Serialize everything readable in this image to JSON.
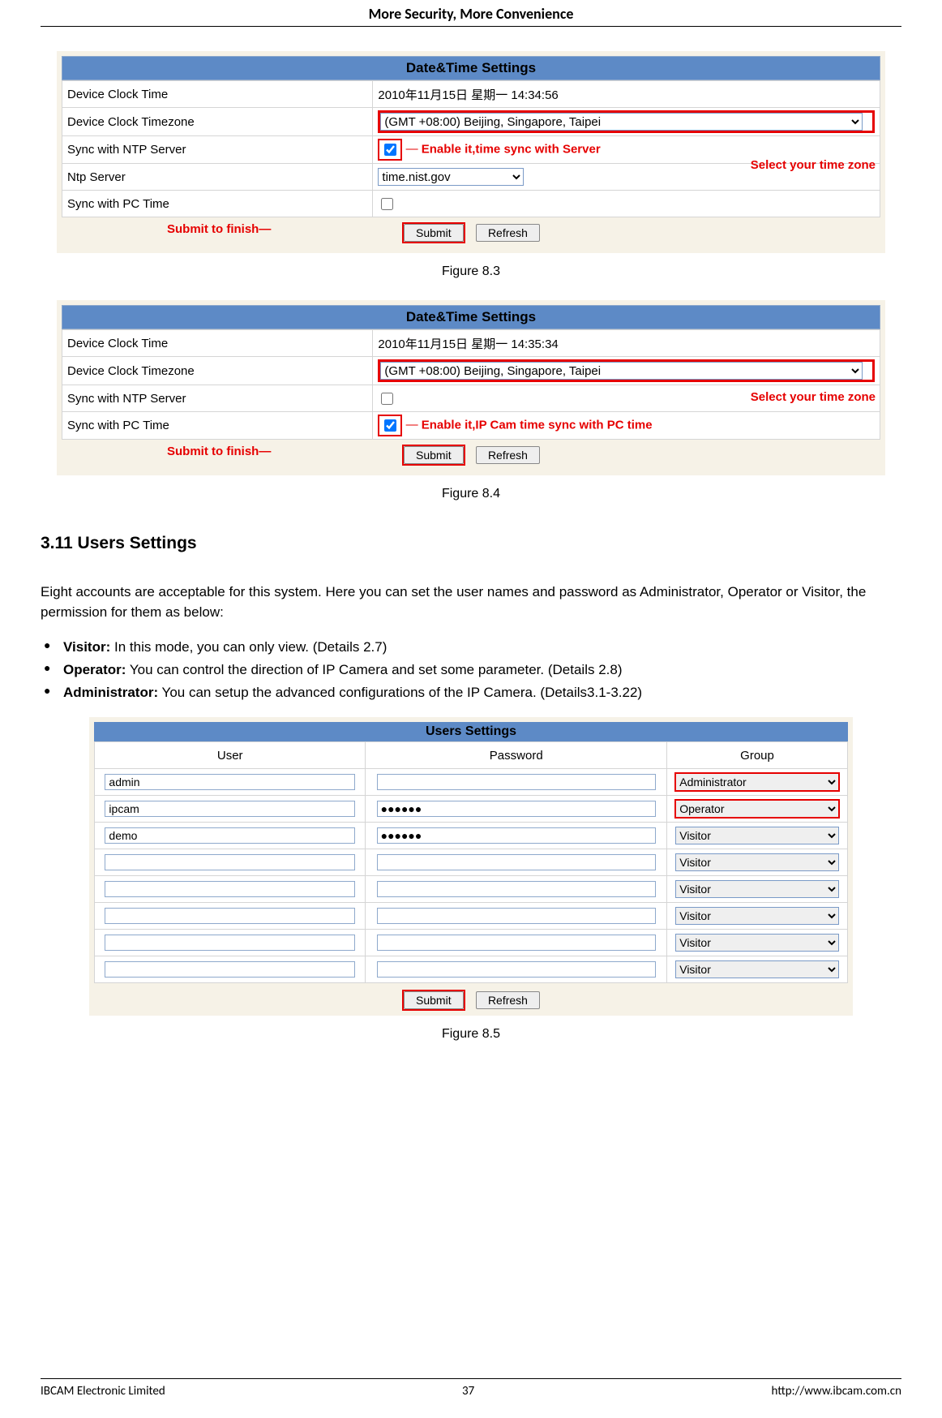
{
  "header": {
    "title": "More Security, More Convenience"
  },
  "figure1": {
    "panel_title": "Date&Time Settings",
    "rows": {
      "r1_label": "Device Clock Time",
      "r1_value": "2010年11月15日 星期一 14:34:56",
      "r2_label": "Device Clock Timezone",
      "r2_value": "(GMT +08:00) Beijing, Singapore, Taipei",
      "r3_label": "Sync with NTP Server",
      "r4_label": "Ntp Server",
      "r4_value": "time.nist.gov",
      "r5_label": "Sync with PC Time"
    },
    "annot_enable": "Enable it,time sync with Server",
    "annot_select_tz": "Select your time zone",
    "annot_submit": "Submit to finish",
    "btn_submit": "Submit",
    "btn_refresh": "Refresh",
    "caption": "Figure 8.3"
  },
  "figure2": {
    "panel_title": "Date&Time Settings",
    "rows": {
      "r1_label": "Device Clock Time",
      "r1_value": "2010年11月15日 星期一 14:35:34",
      "r2_label": "Device Clock Timezone",
      "r2_value": "(GMT +08:00) Beijing, Singapore, Taipei",
      "r3_label": "Sync with NTP Server",
      "r4_label": "Sync with PC Time"
    },
    "annot_select_tz": "Select your time zone",
    "annot_enable": "Enable it,IP Cam time sync with PC time",
    "annot_submit": "Submit to finish",
    "btn_submit": "Submit",
    "btn_refresh": "Refresh",
    "caption": "Figure 8.4"
  },
  "section": {
    "heading": "3.11 Users Settings",
    "para": "Eight accounts are acceptable for this system. Here you can set the user names and password as Administrator, Operator or Visitor, the permission for them as below:",
    "b1_strong": "Visitor:",
    "b1_rest": " In this mode, you can only view. (Details 2.7)",
    "b2_strong": "Operator:",
    "b2_rest": " You can control the direction of IP Camera and set some parameter. (Details 2.8)",
    "b3_strong": "Administrator:",
    "b3_rest": " You can setup the advanced configurations of the IP Camera. (Details3.1-3.22)"
  },
  "users": {
    "title": "Users Settings",
    "col_user": "User",
    "col_pass": "Password",
    "col_group": "Group",
    "rows": [
      {
        "user": "admin",
        "pass": "",
        "group": "Administrator",
        "highlight": true
      },
      {
        "user": "ipcam",
        "pass": "●●●●●●",
        "group": "Operator",
        "highlight": true
      },
      {
        "user": "demo",
        "pass": "●●●●●●",
        "group": "Visitor",
        "highlight": false
      },
      {
        "user": "",
        "pass": "",
        "group": "Visitor",
        "highlight": false
      },
      {
        "user": "",
        "pass": "",
        "group": "Visitor",
        "highlight": false
      },
      {
        "user": "",
        "pass": "",
        "group": "Visitor",
        "highlight": false
      },
      {
        "user": "",
        "pass": "",
        "group": "Visitor",
        "highlight": false
      },
      {
        "user": "",
        "pass": "",
        "group": "Visitor",
        "highlight": false
      }
    ],
    "btn_submit": "Submit",
    "btn_refresh": "Refresh",
    "caption": "Figure 8.5"
  },
  "footer": {
    "left": "IBCAM Electronic Limited",
    "center": "37",
    "right": "http://www.ibcam.com.cn"
  }
}
